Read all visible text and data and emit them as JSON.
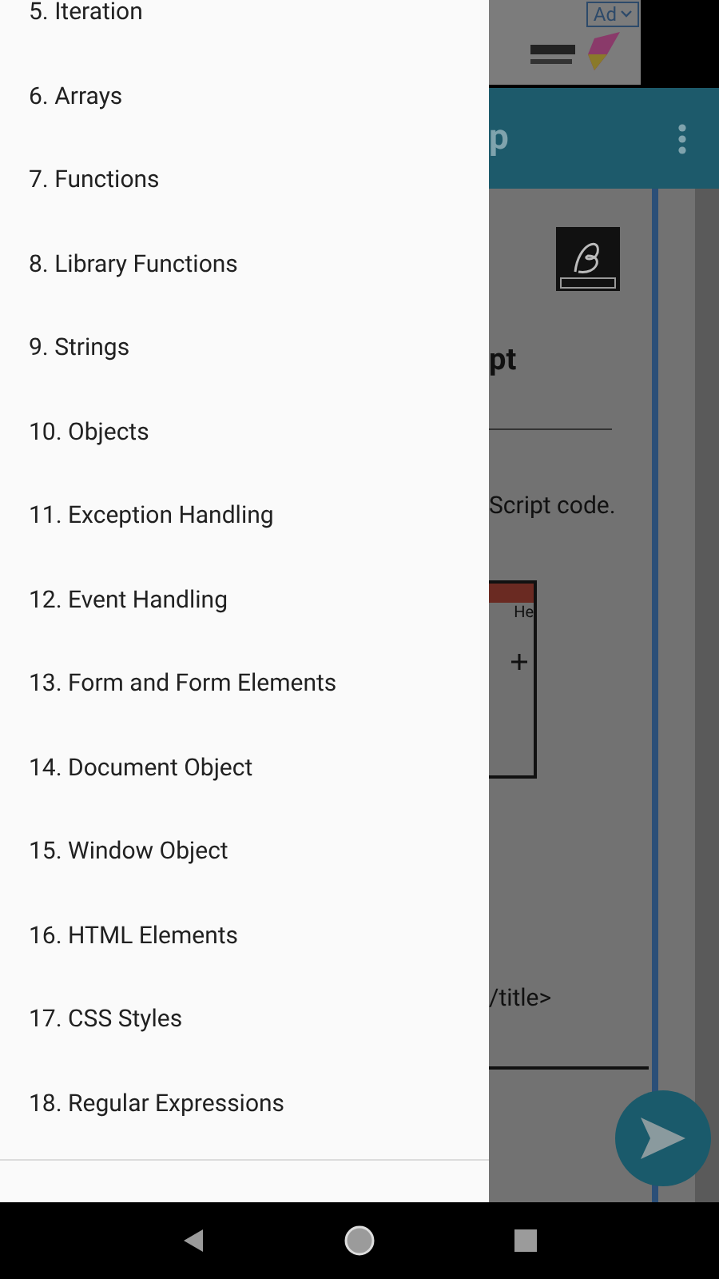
{
  "ad": {
    "label": "Ad"
  },
  "toolbar": {
    "title": "p"
  },
  "page": {
    "heading": "pt",
    "line": "Script code.",
    "code": "/title>",
    "window_menu": "He"
  },
  "drawer": {
    "items": [
      {
        "label": "5. Iteration"
      },
      {
        "label": "6. Arrays"
      },
      {
        "label": "7. Functions"
      },
      {
        "label": "8. Library Functions"
      },
      {
        "label": "9. Strings"
      },
      {
        "label": "10. Objects"
      },
      {
        "label": "11. Exception Handling"
      },
      {
        "label": "12. Event Handling"
      },
      {
        "label": "13. Form and Form Elements"
      },
      {
        "label": "14. Document Object"
      },
      {
        "label": "15. Window Object"
      },
      {
        "label": "16. HTML Elements"
      },
      {
        "label": "17. CSS Styles"
      },
      {
        "label": "18. Regular Expressions"
      }
    ]
  }
}
